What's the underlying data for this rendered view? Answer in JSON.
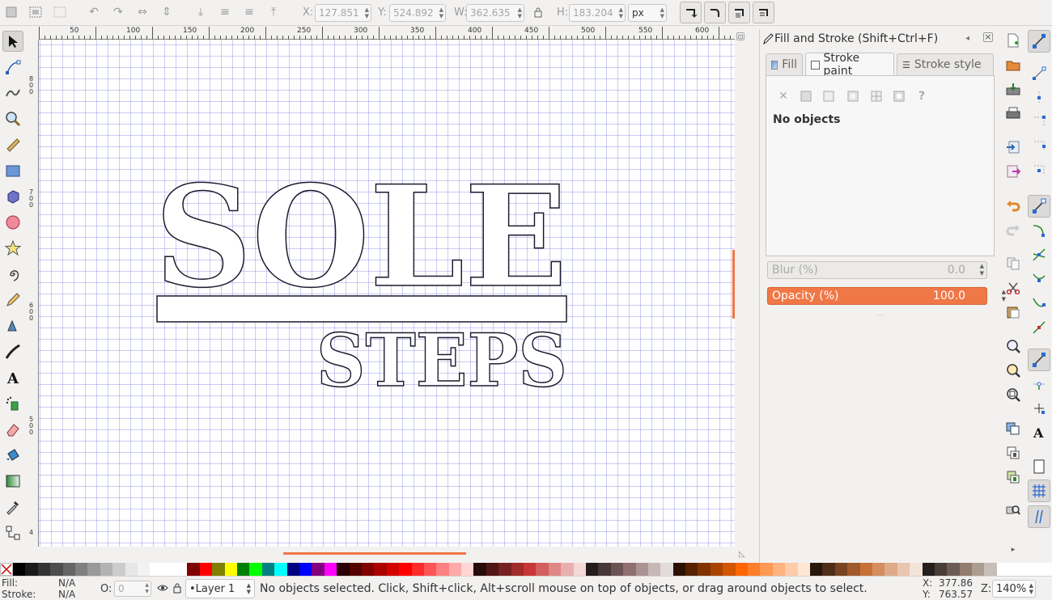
{
  "toolbar": {
    "x_label": "X:",
    "x_value": "127.851",
    "y_label": "Y:",
    "y_value": "524.892",
    "w_label": "W:",
    "w_value": "362.635",
    "h_label": "H:",
    "h_value": "183.204",
    "unit": "px"
  },
  "ruler": {
    "h_ticks": [
      "50",
      "100",
      "150",
      "200",
      "250",
      "300",
      "350",
      "400",
      "450",
      "500",
      "550",
      "600"
    ],
    "v_ticks": [
      "8\n0\n0",
      "7\n0\n0",
      "6\n0\n0",
      "5\n0\n0",
      "4"
    ]
  },
  "artwork": {
    "line1": "SOLE",
    "line2": "STEPS"
  },
  "dock": {
    "title": "Fill and Stroke (Shift+Ctrl+F)",
    "tabs": [
      {
        "label": "Fill"
      },
      {
        "label": "Stroke paint"
      },
      {
        "label": "Stroke style"
      }
    ],
    "paint_question": "?",
    "no_objects": "No objects",
    "blur_label": "Blur (%)",
    "blur_value": "0.0",
    "opacity_label": "Opacity (%)",
    "opacity_value": "100.0"
  },
  "statusbar": {
    "fill_label": "Fill:",
    "fill_value": "N/A",
    "stroke_label": "Stroke:",
    "stroke_value": "N/A",
    "opacity_label": "O:",
    "opacity_value": "0",
    "layer": "•Layer 1",
    "message": "No objects selected. Click, Shift+click, Alt+scroll mouse on top of objects, or drag around objects to select.",
    "cursor_x_label": "X:",
    "cursor_x": "377.86",
    "cursor_y_label": "Y:",
    "cursor_y": "763.57",
    "zoom_label": "Z:",
    "zoom": "140%"
  },
  "palette": [
    "#000000",
    "#1a1a1a",
    "#333333",
    "#4d4d4d",
    "#666666",
    "#808080",
    "#999999",
    "#b3b3b3",
    "#cccccc",
    "#e6e6e6",
    "#f2f2f2",
    "#ffffff",
    "#ffffff",
    "#ffffff",
    "#800000",
    "#ff0000",
    "#808000",
    "#ffff00",
    "#008000",
    "#00ff00",
    "#008080",
    "#00ffff",
    "#000080",
    "#0000ff",
    "#800080",
    "#ff00ff",
    "#2b0000",
    "#550000",
    "#800000",
    "#aa0000",
    "#d40000",
    "#ff0000",
    "#ff2a2a",
    "#ff5555",
    "#ff8080",
    "#ffaaaa",
    "#ffd5d5",
    "#280b0b",
    "#501616",
    "#782121",
    "#a02c2c",
    "#c83737",
    "#d35f5f",
    "#de8787",
    "#e9afaf",
    "#f4d7d7",
    "#241c1c",
    "#483737",
    "#6c5353",
    "#916f6f",
    "#ac9393",
    "#c8b7b7",
    "#e3dbdb",
    "#2b1100",
    "#552200",
    "#803300",
    "#aa4400",
    "#d45500",
    "#ff6600",
    "#ff7f2a",
    "#ff9955",
    "#ffb380",
    "#ffccaa",
    "#ffe6d5",
    "#28170b",
    "#502d16",
    "#784421",
    "#a05a2c",
    "#c87137",
    "#d38d5f",
    "#deaa87",
    "#e9c6af",
    "#f4e3d7",
    "#241f1c",
    "#483e37",
    "#6c5d53",
    "#917c6f",
    "#ac9d93",
    "#c8beb7"
  ]
}
